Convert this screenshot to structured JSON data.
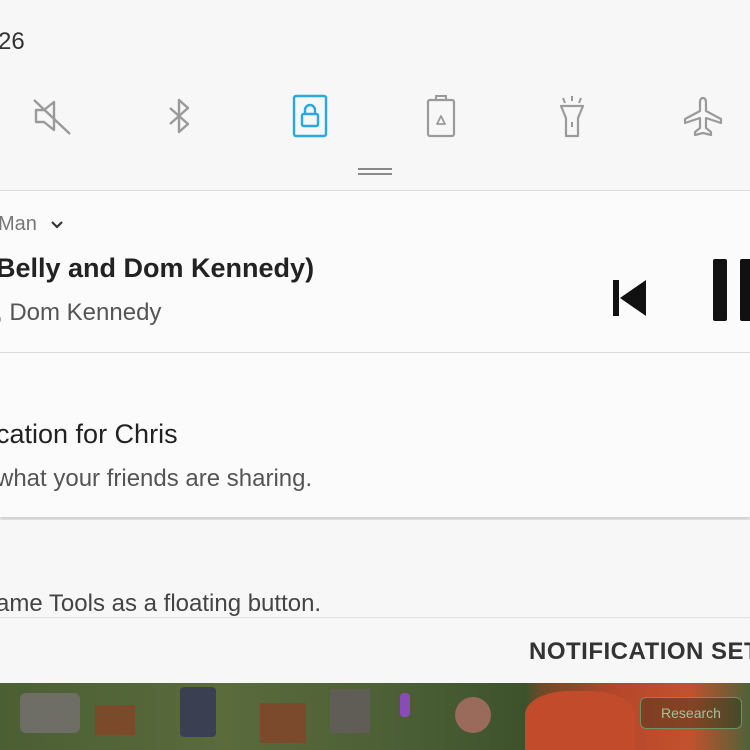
{
  "status_bar": {
    "time_fragment": "26"
  },
  "quick_settings": [
    {
      "name": "sound-off",
      "state": "off"
    },
    {
      "name": "bluetooth",
      "state": "off"
    },
    {
      "name": "screen-lock",
      "state": "on"
    },
    {
      "name": "power-saving",
      "state": "off"
    },
    {
      "name": "flashlight",
      "state": "off"
    },
    {
      "name": "airplane-mode",
      "state": "off"
    }
  ],
  "colors": {
    "accent": "#2aa7e0",
    "icon_inactive": "#9a9a9a"
  },
  "media_notification": {
    "app_name": "Man",
    "title": "Belly and Dom Kennedy)",
    "artist": ", Dom Kennedy"
  },
  "facebook_notification": {
    "app_name": "ı",
    "title": "cation for Chris",
    "text": "what your friends are sharing."
  },
  "game_tools_notification": {
    "text": "ame Tools as a floating button."
  },
  "footer": {
    "settings_label": "NOTIFICATION SETT"
  },
  "background_game": {
    "button_label": "Research"
  }
}
